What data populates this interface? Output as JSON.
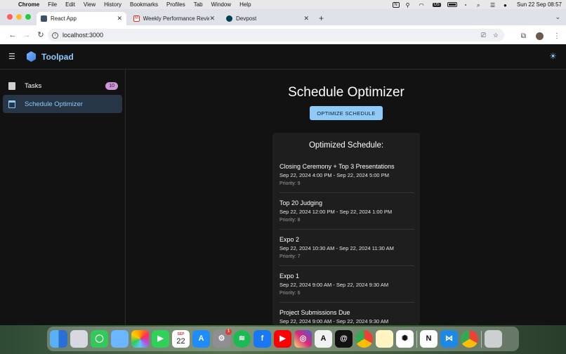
{
  "menubar": {
    "app_name": "Chrome",
    "items": [
      "File",
      "Edit",
      "View",
      "History",
      "Bookmarks",
      "Profiles",
      "Tab",
      "Window",
      "Help"
    ],
    "input_source": "US",
    "datetime": "Sun 22 Sep  08:57"
  },
  "browser": {
    "tabs": [
      {
        "label": "React App",
        "active": true
      },
      {
        "label": "Weekly Performance Review",
        "active": false
      },
      {
        "label": "Devpost",
        "active": false
      }
    ],
    "url": "localhost:3000"
  },
  "app": {
    "brand": "Toolpad",
    "nav": [
      {
        "label": "Tasks",
        "badge": "10",
        "selected": false
      },
      {
        "label": "Schedule Optimizer",
        "selected": true
      }
    ],
    "page_title": "Schedule Optimizer",
    "optimize_button": "OPTIMIZE SCHEDULE",
    "panel_title": "Optimized Schedule:",
    "events": [
      {
        "name": "Closing Ceremony + Top 3 Presentations",
        "time": "Sep 22, 2024 4:00 PM - Sep 22, 2024 5:00 PM",
        "priority": "Priority: 9"
      },
      {
        "name": "Top 20 Judging",
        "time": "Sep 22, 2024 12:00 PM - Sep 22, 2024 1:00 PM",
        "priority": "Priority: 8"
      },
      {
        "name": "Expo 2",
        "time": "Sep 22, 2024 10:30 AM - Sep 22, 2024 11:30 AM",
        "priority": "Priority: 7"
      },
      {
        "name": "Expo 1",
        "time": "Sep 22, 2024 9:00 AM - Sep 22, 2024 9:30 AM",
        "priority": "Priority: 6"
      },
      {
        "name": "Project Submissions Due",
        "time": "Sep 22, 2024 9:00 AM - Sep 22, 2024 9:30 AM",
        "priority": ""
      }
    ]
  },
  "dock": {
    "calendar_month": "SEP",
    "calendar_day": "22",
    "settings_badge": "1"
  },
  "colors": {
    "accent": "#90caf9",
    "badge": "#ce93d8",
    "app_bg": "#121212",
    "panel_bg": "#1e1e1e"
  }
}
